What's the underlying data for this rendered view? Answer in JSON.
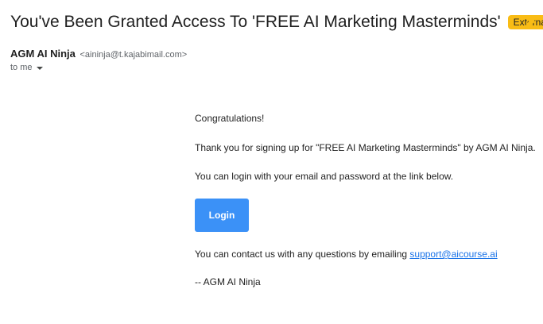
{
  "header": {
    "subject": "You've Been Granted Access To 'FREE AI Marketing Masterminds'",
    "external_badge": "External",
    "badge_color": "#f9bc15",
    "important_marker_color": "#f9bc15"
  },
  "sender": {
    "name": "AGM AI Ninja",
    "email": "<aininja@t.kajabimail.com>",
    "recipient_label": "to me"
  },
  "message": {
    "greeting": "Congratulations!",
    "thanks": "Thank you for signing up for \"FREE AI Marketing Masterminds\" by AGM AI Ninja.",
    "login_info": "You can login with your email and password at the link below.",
    "login_button": "Login",
    "contact_prefix": "You can contact us with any questions by emailing ",
    "contact_email": "support@aicourse.ai",
    "signature": "-- AGM AI Ninja",
    "button_color": "#3b91f7",
    "link_color": "#1a73e8"
  }
}
